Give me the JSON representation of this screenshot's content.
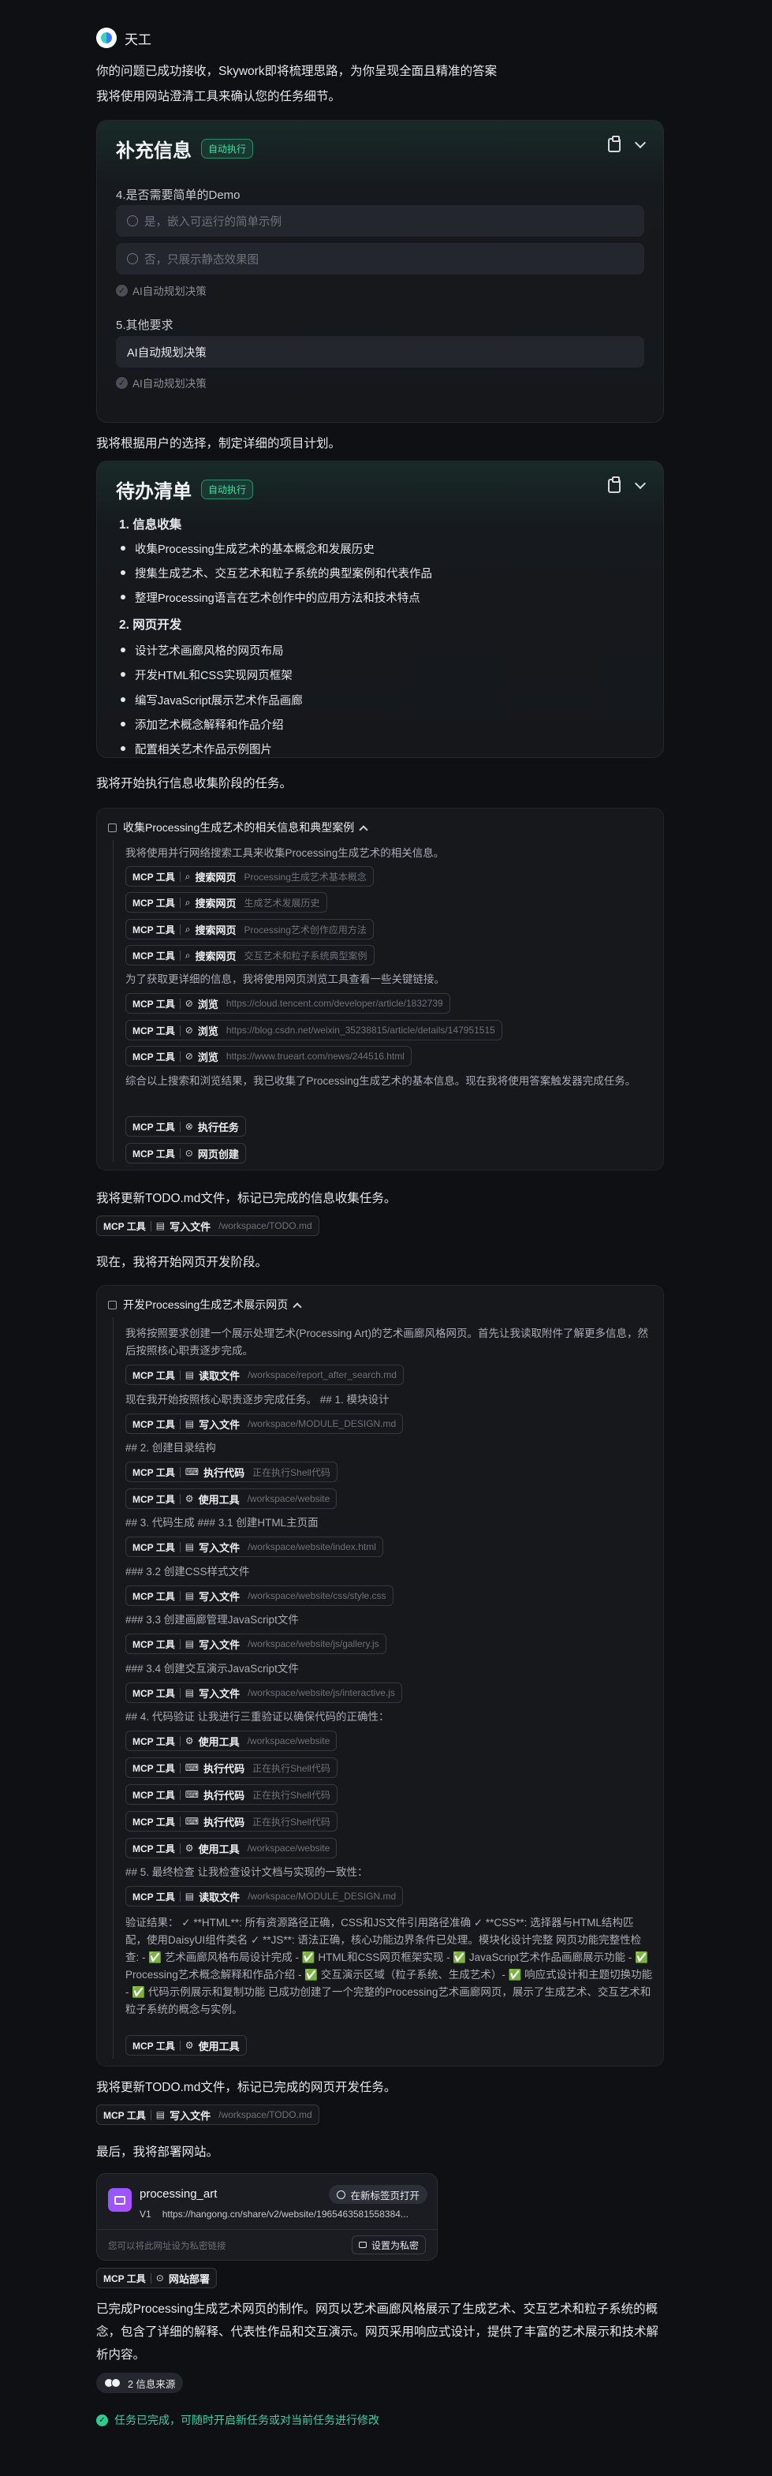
{
  "agent": {
    "name": "天工"
  },
  "msgs": {
    "m1": "你的问题已成功接收，Skywork即将梳理思路，为你呈现全面且精准的答案",
    "m2": "我将使用网站澄清工具来确认您的任务细节。",
    "m3": "我将根据用户的选择，制定详细的项目计划。",
    "m4": "我将开始执行信息收集阶段的任务。",
    "m5": "我将更新TODO.md文件，标记已完成的信息收集任务。",
    "m6": "现在，我将开始网页开发阶段。",
    "m7": "我将更新TODO.md文件，标记已完成的网页开发任务。",
    "m8": "最后，我将部署网站。",
    "m9": "已完成Processing生成艺术网页的制作。网页以艺术画廊风格展示了生成艺术、交互艺术和粒子系统的概念，包含了详细的解释、代表性作品和交互演示。网页采用响应式设计，提供了丰富的艺术展示和技术解析内容。"
  },
  "supplement": {
    "title": "补充信息",
    "badge": "自动执行",
    "q4": "4.是否需要简单的Demo",
    "q4a": "是，嵌入可运行的简单示例",
    "q4b": "否，只展示静态效果图",
    "auto": "AI自动规划决策",
    "q5": "5.其他要求",
    "q5a": "AI自动规划决策"
  },
  "todo": {
    "title": "待办清单",
    "badge": "自动执行",
    "s1": "1. 信息收集",
    "i1": "收集Processing生成艺术的基本概念和发展历史",
    "i2": "搜集生成艺术、交互艺术和粒子系统的典型案例和代表作品",
    "i3": "整理Processing语言在艺术创作中的应用方法和技术特点",
    "s2": "2. 网页开发",
    "i4": "设计艺术画廊风格的网页布局",
    "i5": "开发HTML和CSS实现网页框架",
    "i6": "编写JavaScript展示艺术作品画廊",
    "i7": "添加艺术概念解释和作品介绍",
    "i8": "配置相关艺术作品示例图片"
  },
  "p1": {
    "title": "收集Processing生成艺术的相关信息和典型案例",
    "t1": "我将使用并行网络搜索工具来收集Processing生成艺术的相关信息。",
    "t2": "为了获取更详细的信息，我将使用网页浏览工具查看一些关键链接。",
    "t3": "综合以上搜索和浏览结果，我已收集了Processing生成艺术的基本信息。现在我将使用答案触发器完成任务。",
    "mcp": "MCP 工具",
    "search": "搜索网页",
    "browse": "浏览",
    "exec": "执行任务",
    "create": "网页创建",
    "a1": "Processing生成艺术基本概念",
    "a2": "生成艺术发展历史",
    "a3": "Processing艺术创作应用方法",
    "a4": "交互艺术和粒子系统典型案例",
    "u1": "https://cloud.tencent.com/developer/article/1832739",
    "u2": "https://blog.csdn.net/weixin_35238815/article/details/147951515",
    "u3": "https://www.trueart.com/news/244516.html"
  },
  "w1": {
    "mcp": "MCP 工具",
    "act": "写入文件",
    "arg": "/workspace/TODO.md"
  },
  "p2": {
    "title": "开发Processing生成艺术展示网页",
    "t1": "我将按照要求创建一个展示处理艺术(Processing Art)的艺术画廊风格网页。首先让我读取附件了解更多信息，然后按照核心职责逐步完成。",
    "t2": "现在我开始按照核心职责逐步完成任务。 ## 1. 模块设计",
    "t3": "## 2. 创建目录结构",
    "t4": "## 3. 代码生成 ### 3.1 创建HTML主页面",
    "t5": "### 3.2 创建CSS样式文件",
    "t6": "### 3.3 创建画廊管理JavaScript文件",
    "t7": "### 3.4 创建交互演示JavaScript文件",
    "t8": "## 4. 代码验证 让我进行三重验证以确保代码的正确性：",
    "t9": "## 5. 最终检查 让我检查设计文档与实现的一致性：",
    "t10": "验证结果： ✓ **HTML**: 所有资源路径正确，CSS和JS文件引用路径准确 ✓ **CSS**: 选择器与HTML结构匹配，使用DaisyUI组件类名 ✓ **JS**: 语法正确，核心功能边界条件已处理。模块化设计完整 网页功能完整性检查: - ✅ 艺术画廊风格布局设计完成 - ✅ HTML和CSS网页框架实现 - ✅ JavaScript艺术作品画廊展示功能 - ✅ Processing艺术概念解释和作品介绍 - ✅ 交互演示区域（粒子系统、生成艺术）- ✅ 响应式设计和主题切换功能 - ✅ 代码示例展示和复制功能 已成功创建了一个完整的Processing艺术画廊网页，展示了生成艺术、交互艺术和粒子系统的概念与实例。",
    "mcp": "MCP 工具",
    "read": "读取文件",
    "write": "写入文件",
    "exec": "执行代码",
    "use": "使用工具",
    "a_report": "/workspace/report_after_search.md",
    "a_design": "/workspace/MODULE_DESIGN.md",
    "a_shell": "正在执行Shell代码",
    "a_web": "/workspace/website",
    "a_index": "/workspace/website/index.html",
    "a_css": "/workspace/website/css/style.css",
    "a_gallery": "/workspace/website/js/gallery.js",
    "a_inter": "/workspace/website/js/interactive.js"
  },
  "w2": {
    "mcp": "MCP 工具",
    "act": "写入文件",
    "arg": "/workspace/TODO.md"
  },
  "share": {
    "name": "processing_art",
    "open": "在新标签页打开",
    "ver": "V1",
    "url": "https://hangong.cn/share/v2/website/1965463581558384...",
    "hint": "您可以将此网址设为私密链接",
    "priv": "设置为私密"
  },
  "deploy": {
    "mcp": "MCP 工具",
    "act": "网站部署"
  },
  "sources": "2 信息来源",
  "done": "任务已完成，可随时开启新任务或对当前任务进行修改"
}
